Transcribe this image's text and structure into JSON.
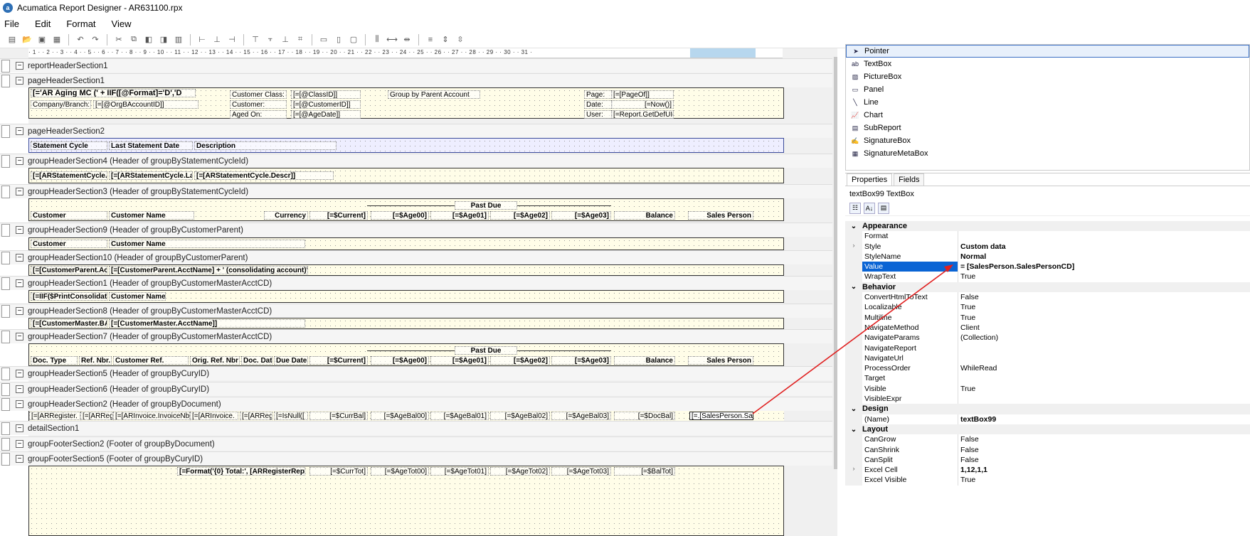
{
  "window": {
    "title": "Acumatica Report Designer - AR631100.rpx",
    "app_icon": "acumatica-logo"
  },
  "menu": [
    "File",
    "Edit",
    "Format",
    "View"
  ],
  "toolbar_icons": [
    "new-report-icon",
    "open-icon",
    "save-icon",
    "save-all-icon",
    "undo-icon",
    "redo-icon",
    "cut-icon",
    "copy-icon",
    "bring-to-front-icon",
    "send-to-back-icon",
    "group-icon",
    "align-left-icon",
    "align-center-icon",
    "align-right-icon",
    "align-top-icon",
    "align-middle-icon",
    "align-bottom-icon",
    "size-to-grid-icon",
    "same-width-icon",
    "same-height-icon",
    "same-size-icon",
    "h-spacing-equal-icon",
    "h-spacing-increase-icon",
    "h-spacing-decrease-icon",
    "v-spacing-equal-icon",
    "v-spacing-increase-icon",
    "v-spacing-decrease-icon"
  ],
  "ruler": "· 1 · · 2 · · 3 · · 4 · · 5 · · 6 · · 7 · · 8 · · 9 · · 10 · · 11 · · 12 · · 13 · · 14 · · 15 · · 16 · · 17 · · 18 · · 19 · · 20 · · 21 · · 22 · · 23 · · 24 · · 25 · · 26 · · 27 · · 28 · · 29 · · 30 · · 31 ·",
  "sections": [
    "reportHeaderSection1",
    "pageHeaderSection1",
    "pageHeaderSection2",
    "groupHeaderSection4 (Header of groupByStatementCycleId)",
    "groupHeaderSection3 (Header of groupByStatementCycleId)",
    "groupHeaderSection9 (Header of groupByCustomerParent)",
    "groupHeaderSection10 (Header of groupByCustomerParent)",
    "groupHeaderSection1 (Header of groupByCustomerMasterAcctCD)",
    "groupHeaderSection8 (Header of groupByCustomerMasterAcctCD)",
    "groupHeaderSection7 (Header of groupByCustomerMasterAcctCD)",
    "groupHeaderSection5 (Header of groupByCuryID)",
    "groupHeaderSection6 (Header of groupByCuryID)",
    "groupHeaderSection2 (Header of groupByDocument)",
    "detailSection1",
    "groupFooterSection2 (Footer of groupByDocument)",
    "groupFooterSection5 (Footer of groupByCuryID)"
  ],
  "page_header1": {
    "c1": "[='AR Aging MC (' + IIF([@Format]='D','D",
    "c2": "Customer Class:",
    "c3": "[=[@ClassID]]",
    "c4": "Group by Parent Account",
    "c5": "Page:",
    "c6": "[=[PageOf]]",
    "c7": "Company/Branch:",
    "c8": "[=[@OrgBAccountID]]",
    "c9": "Customer:",
    "c10": "[=[@CustomerID]]",
    "c11": "Date:",
    "c12": "[=Now()]",
    "c13": "Aged On:",
    "c14": "[=[@AgeDate]]",
    "c15": "User:",
    "c16": "[=Report.GetDefUI("
  },
  "page_header2": {
    "c1": "Statement Cycle",
    "c2": "Last Statement Date",
    "c3": "Description"
  },
  "gh4": {
    "c1": "[=[ARStatementCycle.",
    "c2": "[=[ARStatementCycle.La",
    "c3": "[=[ARStatementCycle.Descr]]"
  },
  "gh3": {
    "past_due": "Past Due",
    "c1": "Customer",
    "c2": "Customer Name",
    "c3": "Currency",
    "c4": "[=$Current]",
    "c5": "[=$Age00]",
    "c6": "[=$Age01]",
    "c7": "[=$Age02]",
    "c8": "[=$Age03]",
    "c9": "Balance",
    "c10": "Sales Person"
  },
  "gh9": {
    "c1": "Customer",
    "c2": "Customer Name"
  },
  "gh10": {
    "c1": "[=[CustomerParent.Ac",
    "c2": "[=[CustomerParent.AcctName] + ' (consolidating account)']"
  },
  "gh1": {
    "c1": "[=IIF($PrintConsolidat",
    "c2": "Customer Name"
  },
  "gh8": {
    "c1": "[=[CustomerMaster.BA",
    "c2": "[=[CustomerMaster.AcctName]]"
  },
  "gh7": {
    "past_due": "Past Due",
    "c1": "Doc. Type",
    "c2": "Ref. Nbr.",
    "c3": "Customer Ref.",
    "c4": "Orig. Ref. Nbr",
    "c5": "Doc. Dat",
    "c6": "Due Date",
    "c7": "[=$Current]",
    "c8": "[=$Age00]",
    "c9": "[=$Age01]",
    "c10": "[=$Age02]",
    "c11": "[=$Age03]",
    "c12": "Balance",
    "c13": "Sales Person"
  },
  "gh2": {
    "c1": "[=[ARRegister.",
    "c2": "[=[ARReg",
    "c3": "[=[ARInvoice.InvoiceNb",
    "c4": "[=[ARInvoice.",
    "c5": "[=[ARRegi",
    "c6": "[=IsNull([",
    "c7": "[=$CurrBal]",
    "c8": "[=$AgeBal00]",
    "c9": "[=$AgeBal01]",
    "c10": "[=$AgeBal02]",
    "c11": "[=$AgeBal03]",
    "c12": "[=$DocBal]",
    "c13": "[=.[SalesPerson.Sa"
  },
  "gf5": {
    "c1": "[=Format('{0} Total:', [ARRegisterRepo",
    "c2": "[=$CurrTot]",
    "c3": "[=$AgeTot00]",
    "c4": "[=$AgeTot01]",
    "c5": "[=$AgeTot02]",
    "c6": "[=$AgeTot03]",
    "c7": "[=$BalTot]"
  },
  "toolbox": [
    {
      "label": "Pointer",
      "icon": "pointer-icon"
    },
    {
      "label": "TextBox",
      "icon": "textbox-icon"
    },
    {
      "label": "PictureBox",
      "icon": "picturebox-icon"
    },
    {
      "label": "Panel",
      "icon": "panel-icon"
    },
    {
      "label": "Line",
      "icon": "line-icon"
    },
    {
      "label": "Chart",
      "icon": "chart-icon"
    },
    {
      "label": "SubReport",
      "icon": "subreport-icon"
    },
    {
      "label": "SignatureBox",
      "icon": "signaturebox-icon"
    },
    {
      "label": "SignatureMetaBox",
      "icon": "signaturemetabox-icon"
    }
  ],
  "properties": {
    "tabs": [
      "Properties",
      "Fields"
    ],
    "object": "textBox99  TextBox",
    "rows": [
      {
        "type": "cat",
        "name": "Appearance"
      },
      {
        "type": "prop",
        "name": "Format",
        "value": ""
      },
      {
        "type": "prop",
        "name": "Style",
        "value": "Custom data",
        "bold": true,
        "expand": true
      },
      {
        "type": "prop",
        "name": "StyleName",
        "value": "Normal",
        "bold": true
      },
      {
        "type": "prop",
        "name": "Value",
        "value": "= [SalesPerson.SalesPersonCD]",
        "bold": true,
        "selected": true
      },
      {
        "type": "prop",
        "name": "WrapText",
        "value": "True"
      },
      {
        "type": "cat",
        "name": "Behavior"
      },
      {
        "type": "prop",
        "name": "ConvertHtmlToText",
        "value": "False"
      },
      {
        "type": "prop",
        "name": "Localizable",
        "value": "True"
      },
      {
        "type": "prop",
        "name": "Multiline",
        "value": "True"
      },
      {
        "type": "prop",
        "name": "NavigateMethod",
        "value": "Client"
      },
      {
        "type": "prop",
        "name": "NavigateParams",
        "value": "(Collection)"
      },
      {
        "type": "prop",
        "name": "NavigateReport",
        "value": ""
      },
      {
        "type": "prop",
        "name": "NavigateUrl",
        "value": ""
      },
      {
        "type": "prop",
        "name": "ProcessOrder",
        "value": "WhileRead"
      },
      {
        "type": "prop",
        "name": "Target",
        "value": ""
      },
      {
        "type": "prop",
        "name": "Visible",
        "value": "True"
      },
      {
        "type": "prop",
        "name": "VisibleExpr",
        "value": ""
      },
      {
        "type": "cat",
        "name": "Design"
      },
      {
        "type": "prop",
        "name": "(Name)",
        "value": "textBox99",
        "bold": true
      },
      {
        "type": "cat",
        "name": "Layout"
      },
      {
        "type": "prop",
        "name": "CanGrow",
        "value": "False"
      },
      {
        "type": "prop",
        "name": "CanShrink",
        "value": "False"
      },
      {
        "type": "prop",
        "name": "CanSplit",
        "value": "False"
      },
      {
        "type": "prop",
        "name": "Excel Cell",
        "value": "1,12,1,1",
        "bold": true,
        "expand": true
      },
      {
        "type": "prop",
        "name": "Excel Visible",
        "value": "True"
      }
    ]
  },
  "colors": {
    "selection": "#0a64d4",
    "arrow": "#e02020",
    "band": "#fffde8"
  }
}
